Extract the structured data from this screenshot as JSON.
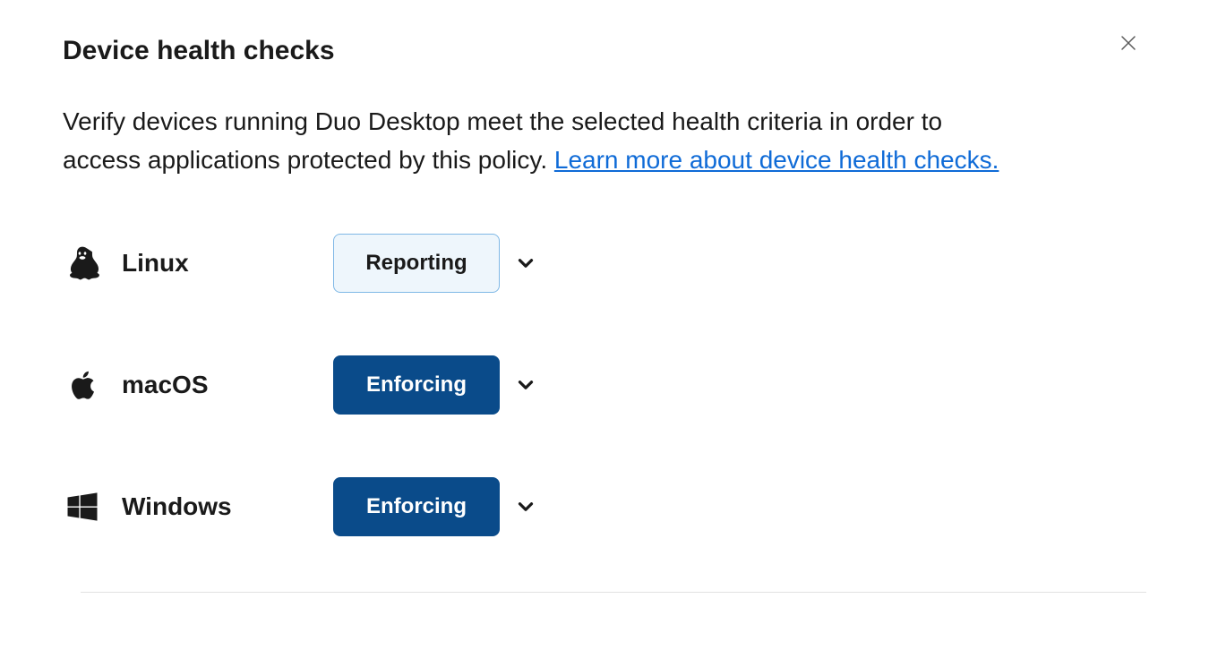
{
  "header": {
    "title": "Device health checks",
    "description_text": "Verify devices running Duo Desktop meet the selected health criteria in order to access applications protected by this policy. ",
    "learn_more_text": "Learn more about device health checks."
  },
  "os_list": [
    {
      "name": "Linux",
      "status": "Reporting",
      "status_style": "reporting"
    },
    {
      "name": "macOS",
      "status": "Enforcing",
      "status_style": "enforcing"
    },
    {
      "name": "Windows",
      "status": "Enforcing",
      "status_style": "enforcing"
    }
  ]
}
